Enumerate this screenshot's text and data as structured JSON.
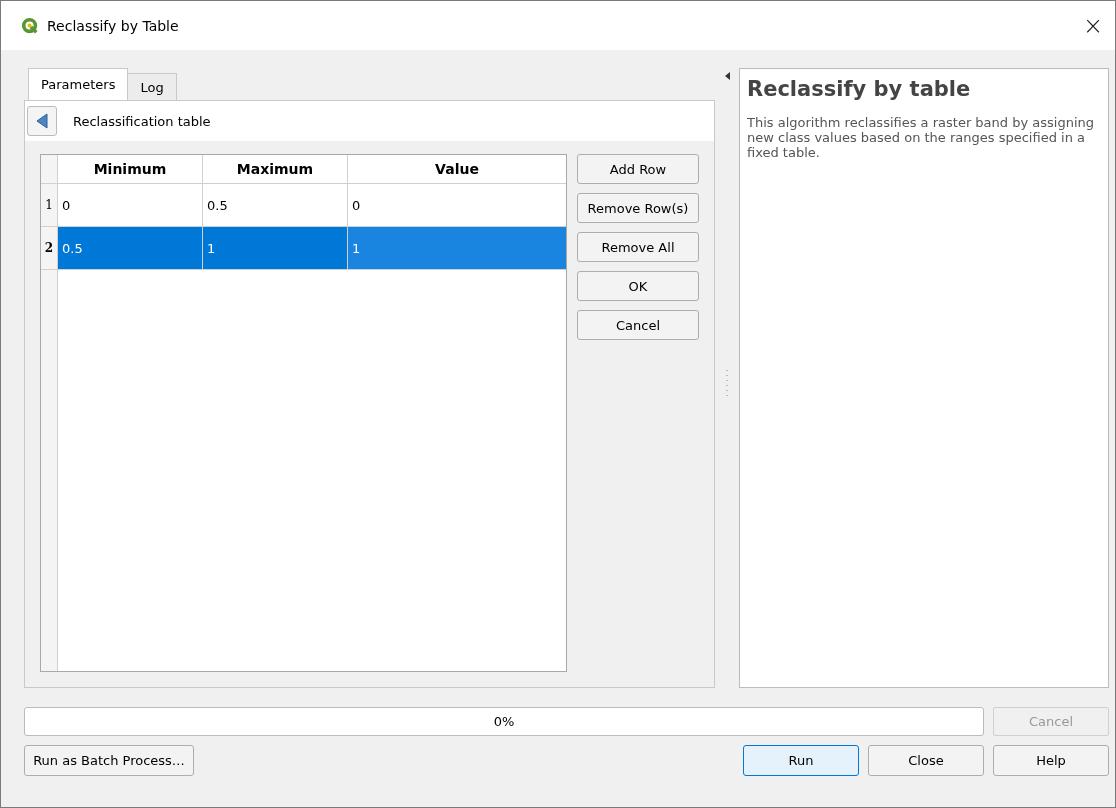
{
  "window": {
    "title": "Reclassify by Table",
    "close": "×"
  },
  "tabs": [
    {
      "label": "Parameters",
      "selected": true
    },
    {
      "label": "Log",
      "selected": false
    }
  ],
  "parameter": {
    "label": "Reclassification table"
  },
  "table": {
    "columns": [
      "Minimum",
      "Maximum",
      "Value"
    ],
    "rows": [
      {
        "index": "1",
        "cells": [
          "0",
          "0.5",
          "0"
        ],
        "selected": false
      },
      {
        "index": "2",
        "cells": [
          "0.5",
          "1",
          "1"
        ],
        "selected": true
      }
    ]
  },
  "table_buttons": [
    "Add Row",
    "Remove Row(s)",
    "Remove All",
    "OK",
    "Cancel"
  ],
  "help": {
    "title": "Reclassify by table",
    "text": "This algorithm reclassifies a raster band by assigning new class values based on the ranges specified in a fixed table."
  },
  "progress": {
    "level": 0,
    "reading": "0%"
  },
  "cancel_button": {
    "label": "Cancel",
    "disabled": true
  },
  "batch_button": "Run as Batch Process…",
  "buttons": [
    {
      "label": "Run",
      "kind": "default"
    },
    {
      "label": "Close",
      "kind": "normal"
    },
    {
      "label": "Help",
      "kind": "normal"
    }
  ]
}
